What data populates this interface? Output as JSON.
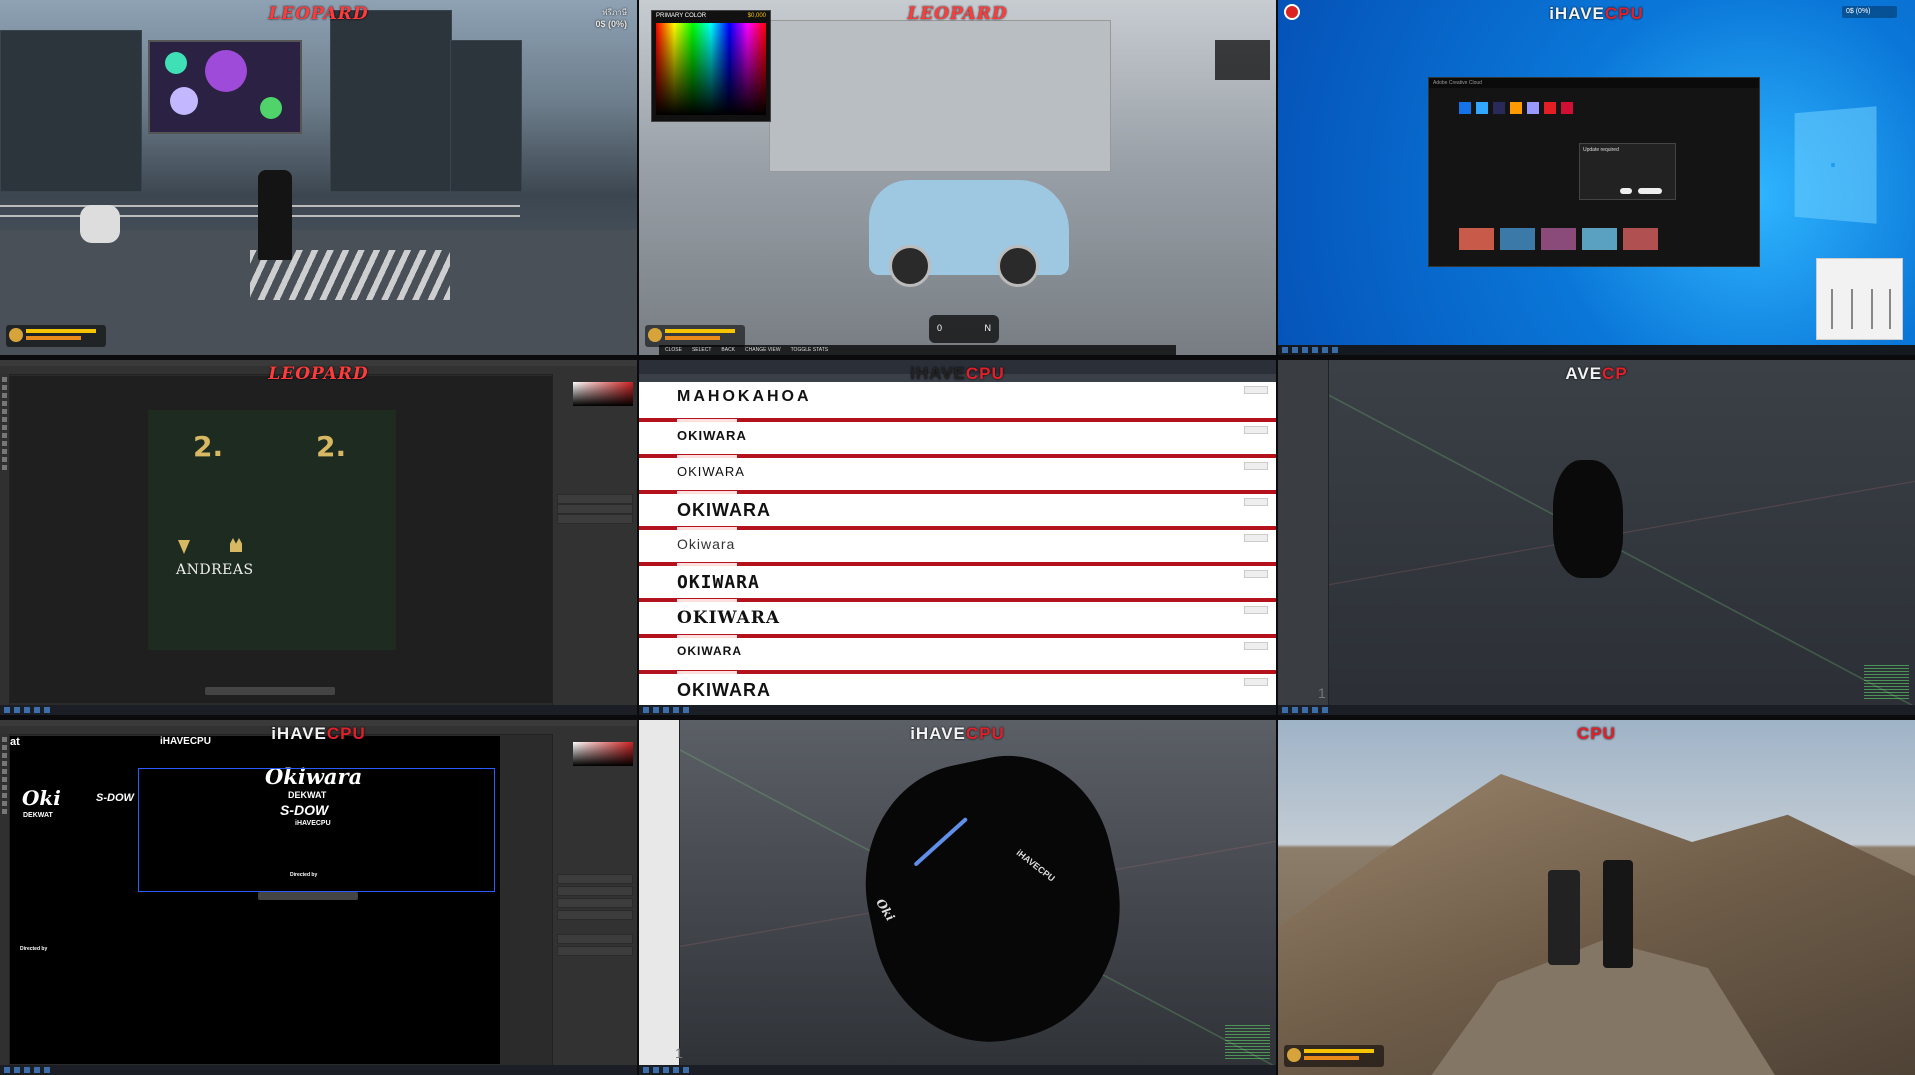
{
  "panels": {
    "p1": {
      "watermark_main": "LEOPARD",
      "watermark_sub": "",
      "money_main": "0$ (0%)",
      "money_sub": "ฟรีภาษี"
    },
    "p2": {
      "watermark_main": "LEOPARD",
      "color_picker_title": "PRIMARY COLOR",
      "color_picker_value": "$0,000",
      "legend": [
        "CLOSE",
        "SELECT",
        "BACK",
        "CHANGE VIEW",
        "TOGGLE STATS"
      ],
      "gear": "N",
      "speed": "0"
    },
    "p3": {
      "watermark_w1": "iHAVE",
      "watermark_w2": "CPU",
      "app_title": "Adobe Creative Cloud",
      "dialog_title": "Update required",
      "money_main": "0$ (0%)"
    },
    "p4": {
      "watermark_main": "LEOPARD",
      "num_left": "2.",
      "num_right": "2.",
      "player_name": "ANDREAS"
    },
    "p5": {
      "watermark_w1": "iHAVE",
      "watermark_w2": "CPU",
      "font_rows": [
        "OKIWARA",
        "OKIWARA",
        "OKIWARA",
        "OKIWARA",
        "Okiwara",
        "OKIWARA",
        "OKIWARA",
        "OKIWARA",
        "OKIWARA"
      ],
      "download_label": "Download",
      "header_preview": "MAHOKAHOA"
    },
    "p6": {
      "watermark_w1": "AVE",
      "watermark_w2": "CP",
      "corner_num": "1"
    },
    "p7": {
      "watermark_w1": "iHAVE",
      "watermark_w2": "CPU",
      "brand_title": "iHAVECPU",
      "brand_left_big": "Oki",
      "brand_left_sub": "DEKWAT",
      "brand_script": "S-DOW",
      "brand_right_big": "Okiwara",
      "brand_right_sub": "DEKWAT",
      "brand_right_script": "S-DOW",
      "brand_right_small": "iHAVECPU",
      "directed_1": "Directed by",
      "directed_2": "Directed by",
      "corner_at": "at"
    },
    "p8": {
      "watermark_w1": "iHAVE",
      "watermark_w2": "CPU",
      "shirt_side_text": "iHAVECPU",
      "shirt_left_text": "Oki",
      "corner_num": "1"
    },
    "p9": {
      "watermark_w1": "",
      "watermark_w2": "CPU"
    }
  },
  "colors": {
    "accent_red": "#e1202a",
    "hud_yellow": "#f6c400",
    "win_blue": "#0a77d8"
  }
}
